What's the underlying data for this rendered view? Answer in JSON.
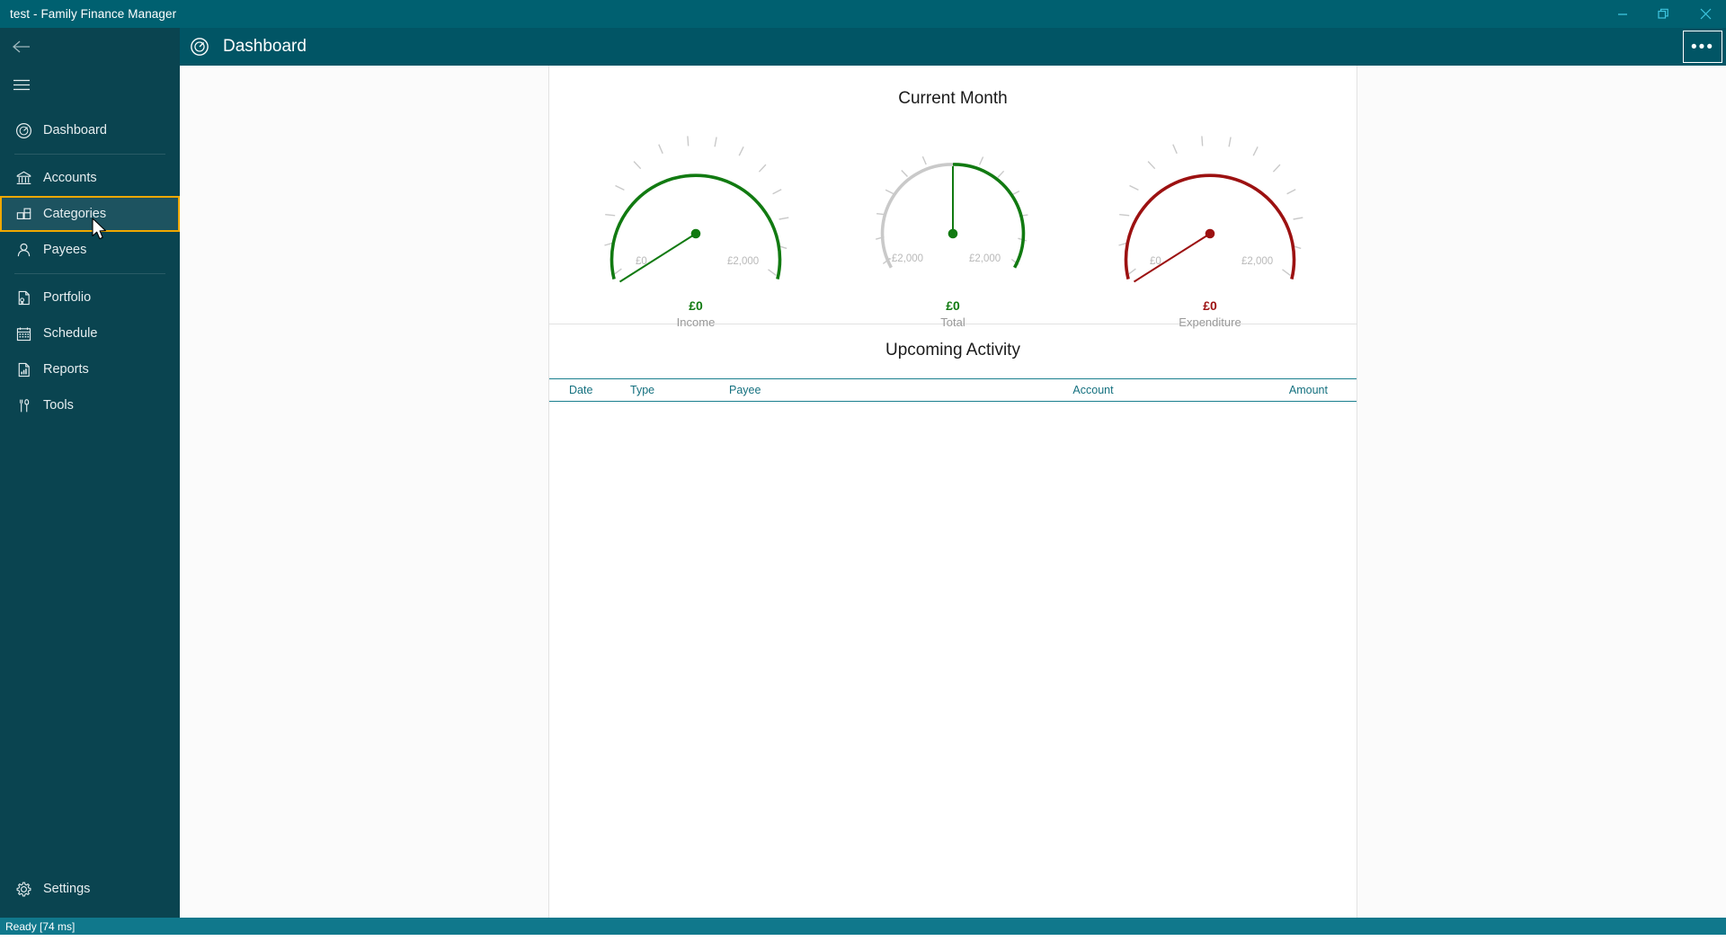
{
  "window": {
    "title": "test - Family Finance Manager",
    "controls": [
      {
        "name": "minimize",
        "glyph": "minimize-icon"
      },
      {
        "name": "restore",
        "glyph": "restore-icon"
      },
      {
        "name": "close",
        "glyph": "close-icon"
      }
    ]
  },
  "sidebar": {
    "back_icon": "back-arrow-icon",
    "menu_icon": "hamburger-menu-icon",
    "items": [
      {
        "label": "Dashboard",
        "icon": "gauge-icon",
        "focused": false
      },
      {
        "label": "Accounts",
        "icon": "bank-icon",
        "focused": false
      },
      {
        "label": "Categories",
        "icon": "categories-grid-icon",
        "focused": true
      },
      {
        "label": "Payees",
        "icon": "person-icon",
        "focused": false
      },
      {
        "label": "Portfolio",
        "icon": "document-seal-icon",
        "focused": false
      },
      {
        "label": "Schedule",
        "icon": "calendar-icon",
        "focused": false
      },
      {
        "label": "Reports",
        "icon": "report-chart-icon",
        "focused": false
      },
      {
        "label": "Tools",
        "icon": "tools-icon",
        "focused": false
      }
    ],
    "settings": {
      "label": "Settings",
      "icon": "gear-icon"
    }
  },
  "header": {
    "title": "Dashboard",
    "icon": "gauge-icon",
    "overflow_label": "•••"
  },
  "main": {
    "current_month_title": "Current Month",
    "upcoming_title": "Upcoming Activity",
    "table": {
      "columns": [
        "Date",
        "Type",
        "Payee",
        "Account",
        "Amount"
      ],
      "rows": []
    }
  },
  "colors": {
    "titlebar": "#006070",
    "sidebar": "#0a4450",
    "header": "#015565",
    "status": "#10788c",
    "focus_border": "#f0a800",
    "income": "#117a11",
    "total": "#117a11",
    "expenditure": "#9c1111",
    "inactive_arc": "#c9c9c9",
    "tick": "#c9c9c9",
    "axis_label": "#b4b4b4",
    "table_accent": "#14707f"
  },
  "chart_data": [
    {
      "type": "gauge",
      "title": "Income",
      "value": 0,
      "value_label": "£0",
      "min": 0,
      "max": 2000,
      "min_label": "£0",
      "max_label": "£2,000",
      "arc_color": "#117a11",
      "filled_fraction": 1.0,
      "needle_value": 0,
      "ticks": 10
    },
    {
      "type": "gauge",
      "title": "Total",
      "value": 0,
      "value_label": "£0",
      "min": -2000,
      "max": 2000,
      "min_label": "-£2,000",
      "max_label": "£2,000",
      "arc_color": "#117a11",
      "negative_arc_color": "#c9c9c9",
      "filled_fraction": 0.5,
      "needle_value": 0,
      "ticks": 10
    },
    {
      "type": "gauge",
      "title": "Expenditure",
      "value": 0,
      "value_label": "£0",
      "min": 0,
      "max": 2000,
      "min_label": "£0",
      "max_label": "£2,000",
      "arc_color": "#9c1111",
      "filled_fraction": 1.0,
      "needle_value": 0,
      "ticks": 10
    }
  ],
  "statusbar": {
    "text": "Ready [74 ms]"
  }
}
